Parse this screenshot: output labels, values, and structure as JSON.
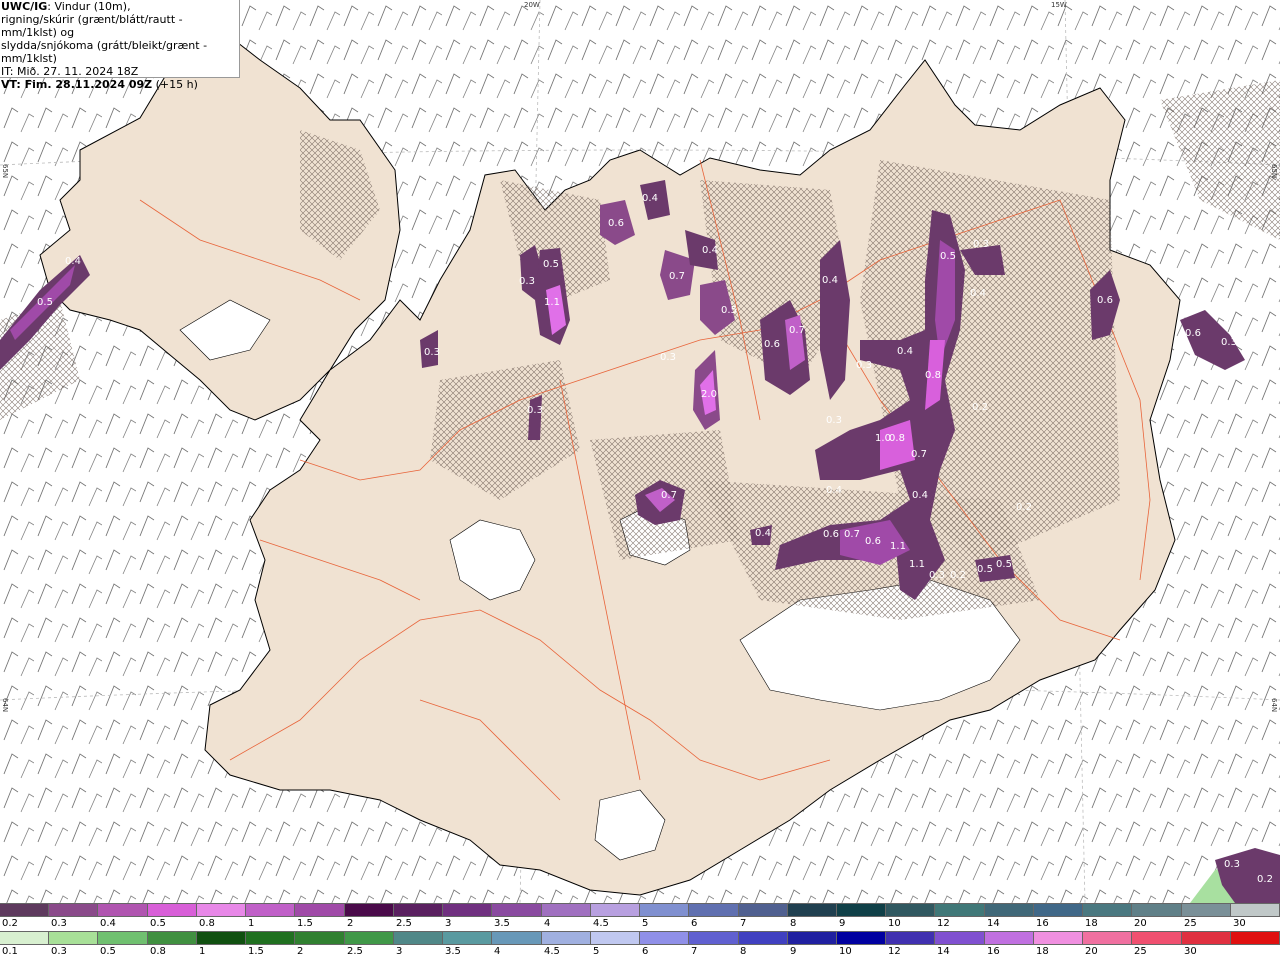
{
  "header": {
    "brand": "UWC/IG",
    "line1_rest": ": Vindur (10m),",
    "line2": "rigning/skúrir (grænt/blátt/rautt - mm/1klst) og",
    "line3": "slydda/snjókoma (grátt/bleikt/grænt - mm/1klst)",
    "line4": "IT: Mið. 27. 11. 2024 18Z",
    "line5_label": "VT: Fim. 28.11.2024 09Z",
    "line5_rest": " (+15 h)"
  },
  "graticule": {
    "top_20w": "20W",
    "top_15w": "15W",
    "left_65n": "65N",
    "right_65n": "65N",
    "left_64n": "64N",
    "right_64n": "64N"
  },
  "colors": {
    "land": "#f0e2d2",
    "coast": "#000000",
    "roads": "#e8643a",
    "snow_dark": "#5e2c5e",
    "snow_mid": "#a23aa6",
    "snow_light": "#e47ae8",
    "rain_green": "#a8e0a0"
  },
  "precip_labels": [
    "0.4",
    "0.5",
    "0.3",
    "0.4",
    "0.6",
    "0.4",
    "0.5",
    "1.1",
    "0.3",
    "0.7",
    "0.4",
    "0.5",
    "0.3",
    "2.0",
    "0.6",
    "0.7",
    "0.4",
    "0.3",
    "0.5",
    "0.3",
    "0.4",
    "0.8",
    "0.3",
    "0.2",
    "1.0",
    "0.8",
    "0.7",
    "0.4",
    "0.4",
    "0.7",
    "0.4",
    "0.6",
    "0.7",
    "0.6",
    "1.1",
    "1.1",
    "0.3",
    "0.2",
    "0.5",
    "0.5",
    "0.6",
    "0.6",
    "0.3",
    "0.3",
    "0.2",
    "0.3",
    "0.2"
  ],
  "legend_snow": {
    "colors": [
      "#5e3a5e",
      "#8a4a8a",
      "#b055b0",
      "#d85fd8",
      "#e888e8",
      "#c060c8",
      "#a04aa8",
      "#4a0a4a",
      "#5a2060",
      "#703080",
      "#8a4aa0",
      "#a070c0",
      "#b8a0e0",
      "#8090d0",
      "#6070b0",
      "#506090",
      "#204050",
      "#104048",
      "#305860",
      "#407878",
      "#406878",
      "#406888",
      "#4a7880",
      "#608088",
      "#7a9098",
      "#c0c8c8"
    ],
    "ticks": [
      "0.2",
      "0.3",
      "0.4",
      "0.5",
      "0.8",
      "1",
      "1.5",
      "2",
      "2.5",
      "3",
      "3.5",
      "4",
      "4.5",
      "5",
      "6",
      "7",
      "8",
      "9",
      "10",
      "12",
      "14",
      "16",
      "18",
      "20",
      "25",
      "30"
    ]
  },
  "legend_rain": {
    "colors": [
      "#d8f0d0",
      "#a8e098",
      "#70c070",
      "#409040",
      "#105010",
      "#207020",
      "#308030",
      "#409848",
      "#508888",
      "#5a9aa0",
      "#6898b8",
      "#a0b0e0",
      "#c0c8f0",
      "#9090e8",
      "#6060d0",
      "#4040c0",
      "#2020a0",
      "#0000a0",
      "#4030b0",
      "#8050d0",
      "#c070e0",
      "#f090e0",
      "#f070a0",
      "#f05070",
      "#e03040",
      "#e01010"
    ],
    "ticks": [
      "0.1",
      "0.3",
      "0.5",
      "0.8",
      "1",
      "1.5",
      "2",
      "2.5",
      "3",
      "3.5",
      "4",
      "4.5",
      "5",
      "6",
      "7",
      "8",
      "9",
      "10",
      "12",
      "14",
      "16",
      "18",
      "20",
      "25",
      "30"
    ]
  }
}
